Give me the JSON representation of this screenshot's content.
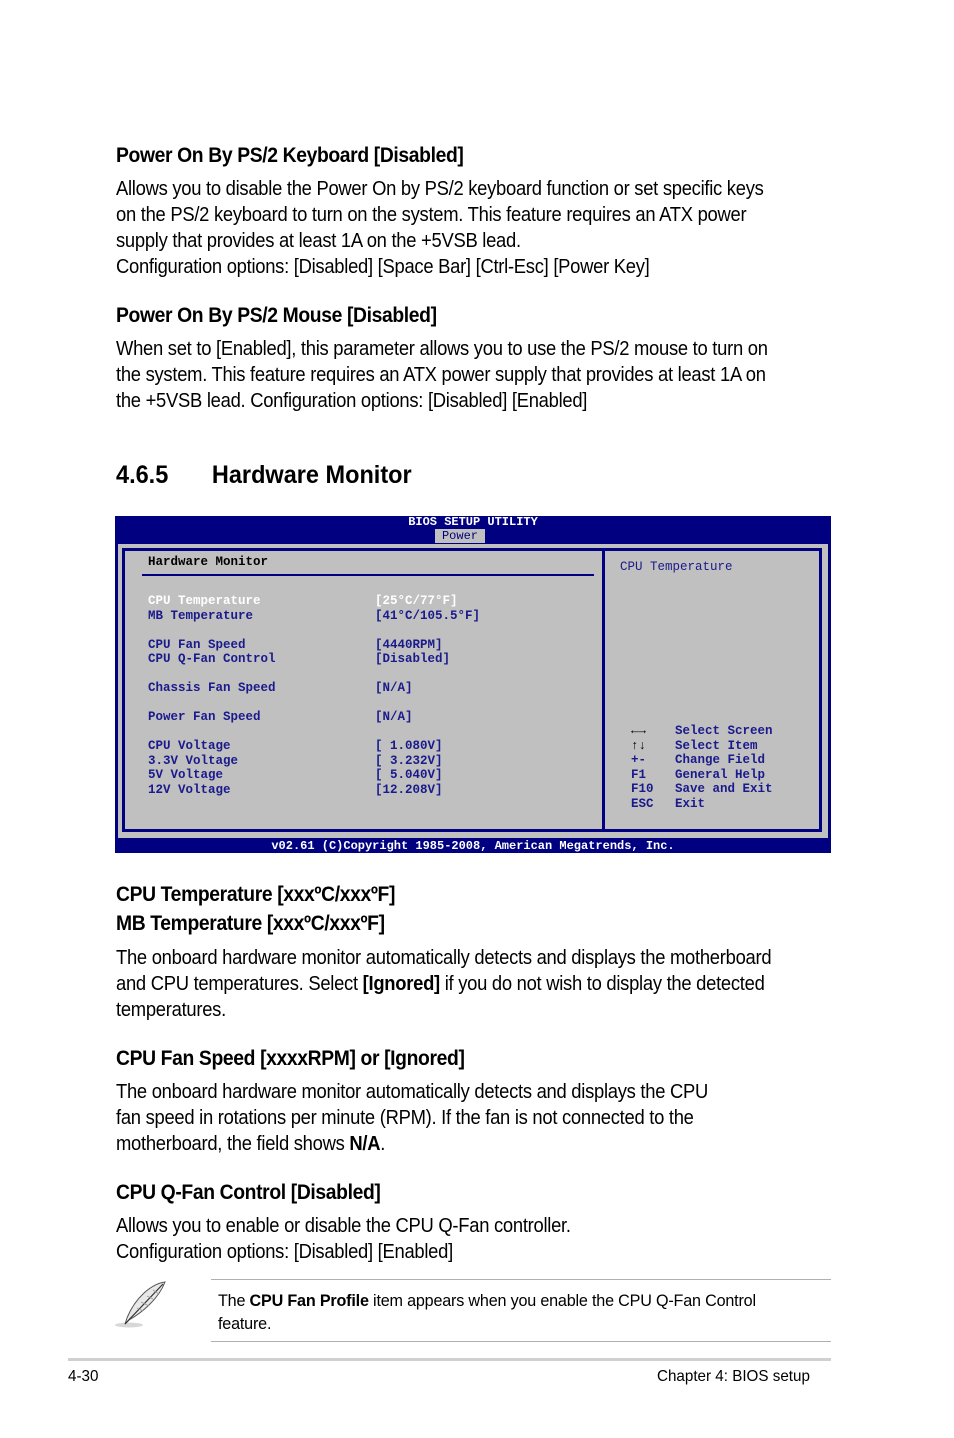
{
  "sections": {
    "kb_title": "Power On By PS/2 Keyboard [Disabled]",
    "kb_lines": [
      "Allows you to disable the Power On by PS/2 keyboard function or set specific keys",
      "on the PS/2 keyboard to turn on the system. This feature requires an ATX power",
      "supply that provides at least 1A on the +5VSB lead.",
      "Configuration options: [Disabled] [Space Bar] [Ctrl-Esc] [Power Key]"
    ],
    "mouse_title": "Power On By PS/2 Mouse [Disabled]",
    "mouse_lines": [
      "When set to [Enabled], this parameter allows you to use the PS/2 mouse to turn on",
      "the system. This feature requires an ATX power supply that provides at least 1A on",
      "the +5VSB lead. Configuration options: [Disabled] [Enabled]"
    ],
    "hm_number": "4.6.5",
    "hm_title": "Hardware Monitor",
    "temp_title_1": "CPU Temperature [xxxºC/xxxºF]",
    "temp_title_2": "MB Temperature [xxxºC/xxxºF]",
    "temp_line_1": "The onboard hardware monitor automatically detects and displays the motherboard",
    "temp_line_2_pre": "and CPU temperatures. Select ",
    "temp_line_2_bold": "[Ignored]",
    "temp_line_2_post": " if you do not wish to display the detected",
    "temp_line_3": "temperatures.",
    "fan_title": "CPU Fan Speed [xxxxRPM] or [Ignored]",
    "fan_line_1": "The onboard hardware monitor automatically detects and displays the CPU",
    "fan_line_2": "fan speed in rotations per minute (RPM). If the fan is not connected to the",
    "fan_line_3_pre": "motherboard, the field shows ",
    "fan_line_3_bold": "N/A",
    "fan_line_3_post": ".",
    "qfan_title": "CPU Q-Fan Control [Disabled]",
    "qfan_line_1": "Allows you to enable or disable the CPU Q-Fan controller.",
    "qfan_line_2": "Configuration options: [Disabled] [Enabled]"
  },
  "bios": {
    "title": "BIOS SETUP UTILITY",
    "active_tab": "Power",
    "heading": "Hardware Monitor",
    "rows": [
      {
        "label": "CPU Temperature",
        "value": "[25°C/77°F]",
        "selected": true
      },
      {
        "label": "MB Temperature",
        "value": "[41°C/105.5°F]"
      },
      {
        "label": "CPU Fan Speed",
        "value": "[4440RPM]"
      },
      {
        "label": "CPU Q-Fan Control",
        "value": "[Disabled]"
      },
      {
        "label": "Chassis Fan Speed",
        "value": "[N/A]"
      },
      {
        "label": "Power Fan Speed",
        "value": "[N/A]"
      },
      {
        "label": "CPU Voltage",
        "value": "[ 1.080V]"
      },
      {
        "label": "3.3V Voltage",
        "value": "[ 3.232V]"
      },
      {
        "label": "5V Voltage",
        "value": "[ 5.040V]"
      },
      {
        "label": "12V Voltage",
        "value": "[12.208V]"
      }
    ],
    "help_title": "CPU Temperature",
    "keys": [
      {
        "key": "←→",
        "icon": "left-right-arrows-icon",
        "desc": "Select Screen"
      },
      {
        "key": "↑↓",
        "icon": "up-down-arrows-icon",
        "desc": "Select Item"
      },
      {
        "key": "+-",
        "desc": "Change Field"
      },
      {
        "key": "F1",
        "desc": "General Help"
      },
      {
        "key": "F10",
        "desc": "Save and Exit"
      },
      {
        "key": "ESC",
        "desc": "Exit"
      }
    ],
    "footer": "v02.61 (C)Copyright 1985-2008, American Megatrends, Inc."
  },
  "note": {
    "pre": "The ",
    "bold": "CPU Fan Profile",
    "post": " item appears when you enable the CPU Q-Fan Control",
    "line2": "feature."
  },
  "footer": {
    "page_number": "4-30",
    "chapter": "Chapter 4: BIOS setup"
  }
}
